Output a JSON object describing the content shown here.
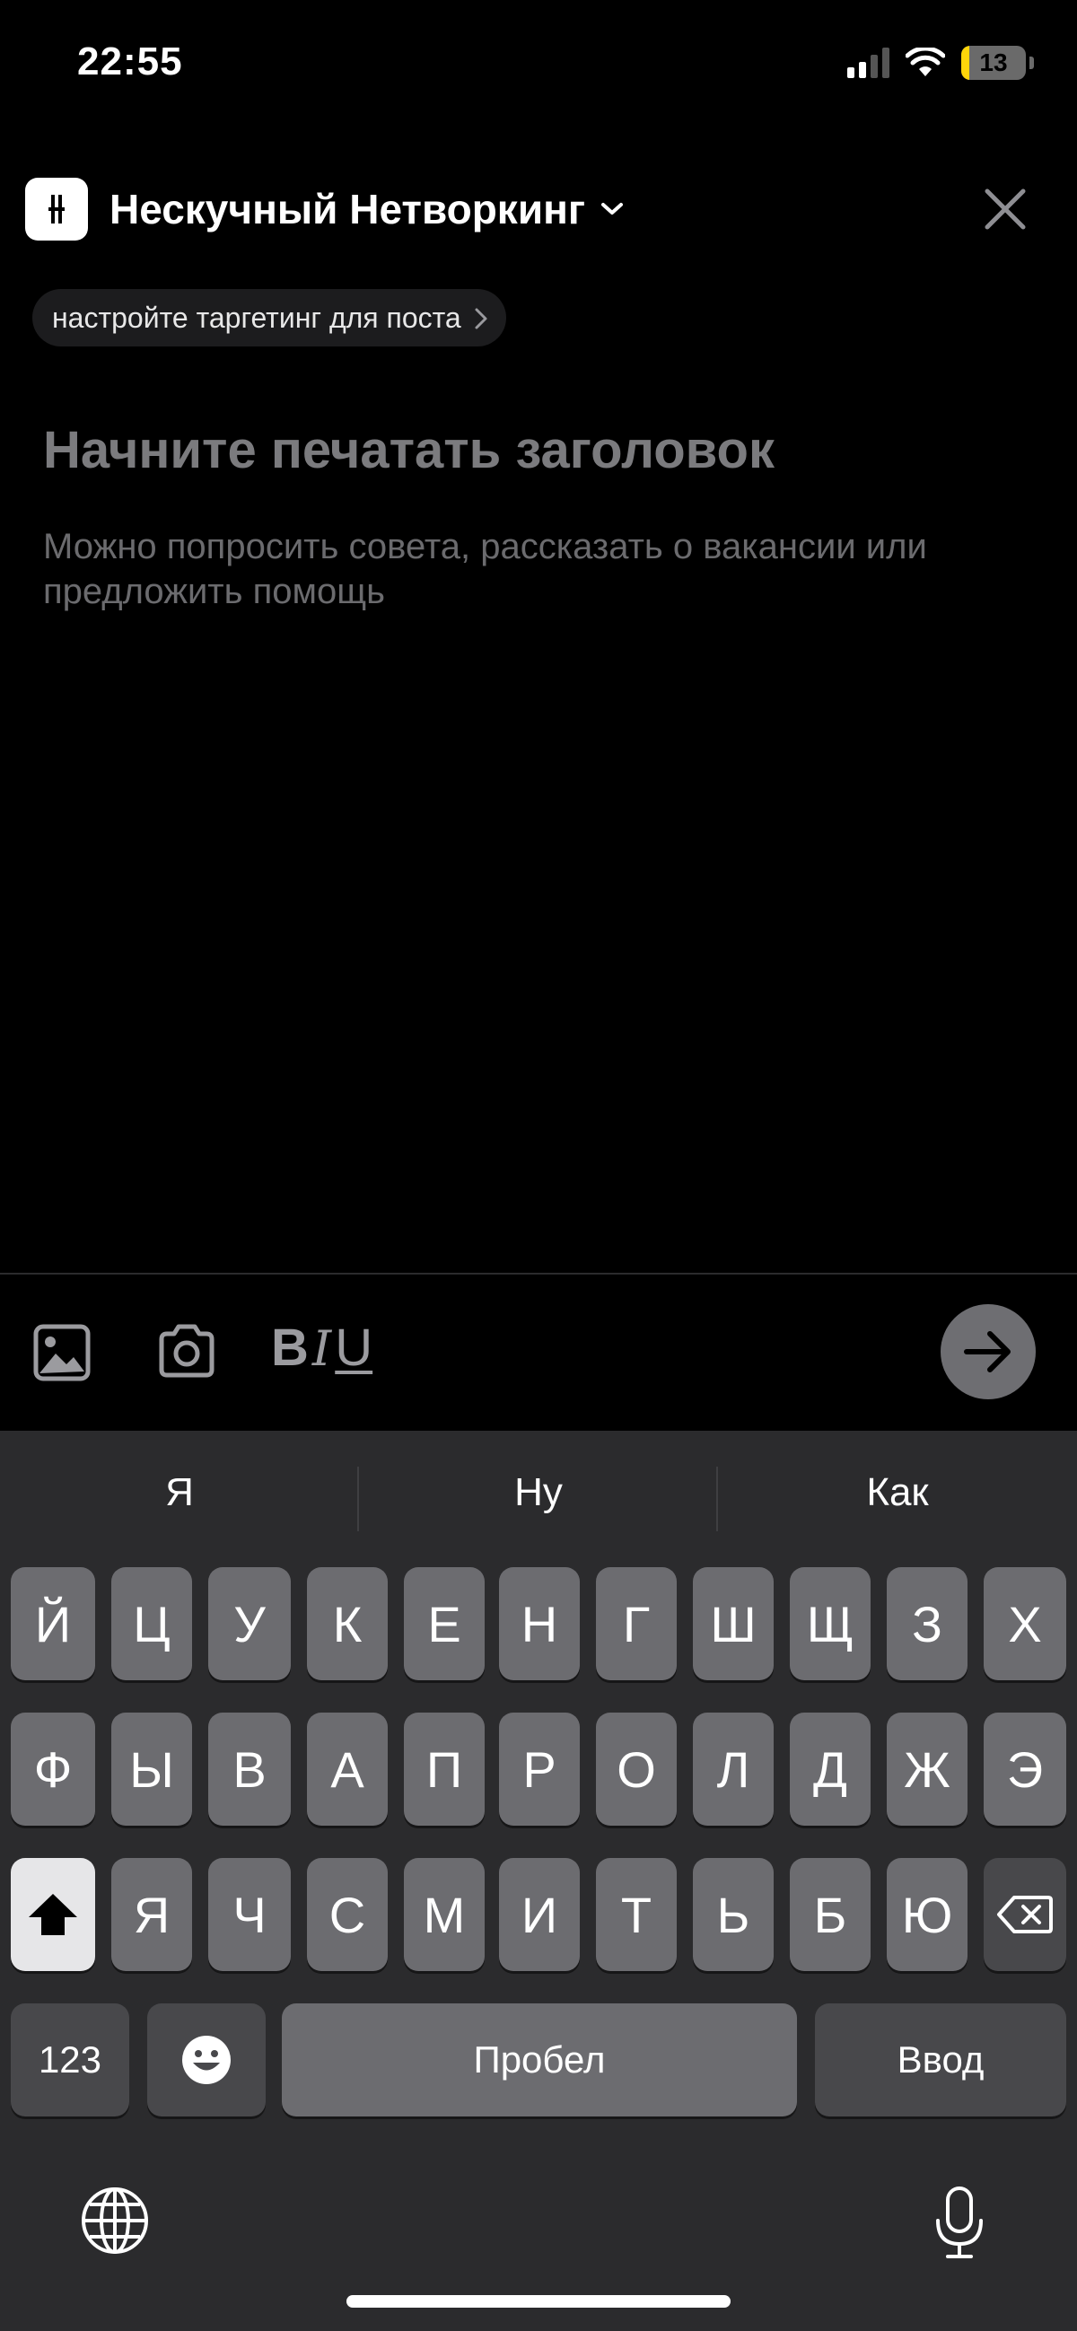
{
  "status_bar": {
    "time": "22:55",
    "battery": "13",
    "battery_level": 0.13
  },
  "header": {
    "community_name": "Нескучный Нетворкинг",
    "targeting_label": "настройте таргетинг для поста"
  },
  "editor": {
    "title_placeholder": "Начните печатать заголовок",
    "body_placeholder": "Можно попросить совета, рассказать о вакансии или предложить помощь"
  },
  "toolbar": {
    "bold": "B",
    "italic": "I",
    "underline": "U"
  },
  "keyboard": {
    "suggestions": [
      "Я",
      "Ну",
      "Как"
    ],
    "row1": [
      "Й",
      "Ц",
      "У",
      "К",
      "Е",
      "Н",
      "Г",
      "Ш",
      "Щ",
      "З",
      "Х"
    ],
    "row2": [
      "Ф",
      "Ы",
      "В",
      "А",
      "П",
      "Р",
      "О",
      "Л",
      "Д",
      "Ж",
      "Э"
    ],
    "row3": [
      "Я",
      "Ч",
      "С",
      "М",
      "И",
      "Т",
      "Ь",
      "Б",
      "Ю"
    ],
    "numbers_key": "123",
    "space_key": "Пробел",
    "return_key": "Ввод",
    "icons": [
      "shift-icon",
      "backspace-icon",
      "emoji-icon",
      "globe-icon",
      "microphone-icon"
    ]
  },
  "colors": {
    "accent_battery": "#ffd60a",
    "background": "#000000",
    "keyboard": "#2b2b2d"
  }
}
